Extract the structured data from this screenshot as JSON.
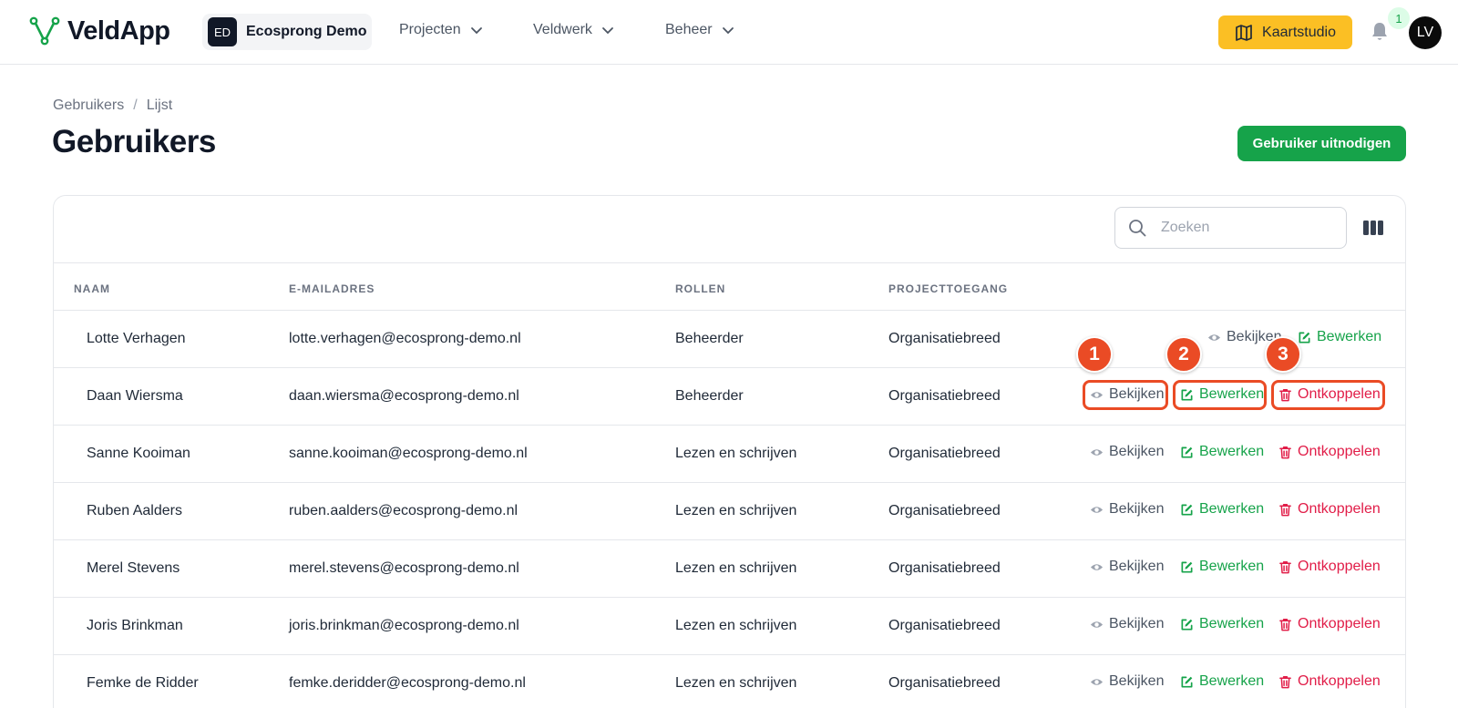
{
  "app": {
    "brand": "VeldApp"
  },
  "org": {
    "initials": "ED",
    "name": "Ecosprong Demo"
  },
  "nav": [
    {
      "label": "Projecten"
    },
    {
      "label": "Veldwerk"
    },
    {
      "label": "Beheer"
    }
  ],
  "toolbar": {
    "kaartstudio": "Kaartstudio",
    "notifications": "1",
    "user_initials": "LV"
  },
  "breadcrumb": {
    "parent": "Gebruikers",
    "separator": "/",
    "current": "Lijst"
  },
  "page": {
    "title": "Gebruikers",
    "invite_button": "Gebruiker uitnodigen"
  },
  "search": {
    "placeholder": "Zoeken",
    "value": ""
  },
  "table": {
    "headers": {
      "name": "NAAM",
      "email": "E-MAILADRES",
      "roles": "ROLLEN",
      "access": "PROJECTTOEGANG"
    },
    "actions": {
      "view": "Bekijken",
      "edit": "Bewerken",
      "unlink": "Ontkoppelen"
    },
    "rows": [
      {
        "name": "Lotte Verhagen",
        "email": "lotte.verhagen@ecosprong-demo.nl",
        "role": "Beheerder",
        "access": "Organisatiebreed"
      },
      {
        "name": "Daan Wiersma",
        "email": "daan.wiersma@ecosprong-demo.nl",
        "role": "Beheerder",
        "access": "Organisatiebreed"
      },
      {
        "name": "Sanne Kooiman",
        "email": "sanne.kooiman@ecosprong-demo.nl",
        "role": "Lezen en schrijven",
        "access": "Organisatiebreed"
      },
      {
        "name": "Ruben Aalders",
        "email": "ruben.aalders@ecosprong-demo.nl",
        "role": "Lezen en schrijven",
        "access": "Organisatiebreed"
      },
      {
        "name": "Merel Stevens",
        "email": "merel.stevens@ecosprong-demo.nl",
        "role": "Lezen en schrijven",
        "access": "Organisatiebreed"
      },
      {
        "name": "Joris Brinkman",
        "email": "joris.brinkman@ecosprong-demo.nl",
        "role": "Lezen en schrijven",
        "access": "Organisatiebreed"
      },
      {
        "name": "Femke de Ridder",
        "email": "femke.deridder@ecosprong-demo.nl",
        "role": "Lezen en schrijven",
        "access": "Organisatiebreed"
      }
    ]
  },
  "annotations": {
    "markers": [
      "1",
      "2",
      "3"
    ]
  },
  "colors": {
    "accent": "#16a34a",
    "warning": "#fbbf24",
    "danger": "#e11d48",
    "annotation": "#ea4b25"
  }
}
